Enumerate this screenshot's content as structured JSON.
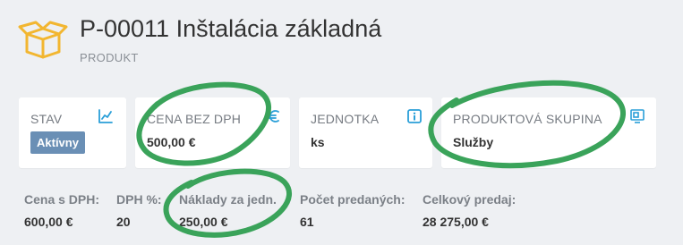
{
  "header": {
    "title": "P-00011 Inštalácia základná",
    "subtitle": "PRODUKT",
    "icon": "box-icon"
  },
  "cards": [
    {
      "label": "STAV",
      "value": "Aktívny",
      "icon": "trend-chart-icon"
    },
    {
      "label": "CENA BEZ DPH",
      "value": "500,00 €",
      "icon": "euro-icon"
    },
    {
      "label": "JEDNOTKA",
      "value": "ks",
      "icon": "info-icon"
    },
    {
      "label": "PRODUKTOVÁ SKUPINA",
      "value": "Služby",
      "icon": "group-icon"
    }
  ],
  "stats": [
    {
      "label": "Cena s DPH:",
      "value": "600,00 €"
    },
    {
      "label": "DPH %:",
      "value": "20"
    },
    {
      "label": "Náklady za jedn.",
      "value": "250,00 €"
    },
    {
      "label": "Počet predaných:",
      "value": "61"
    },
    {
      "label": "Celkový predaj:",
      "value": "28 275,00 €"
    }
  ],
  "colors": {
    "accent": "#2a9fd8",
    "icon_yellow": "#f2b630",
    "badge": "#6a8fb5",
    "highlight": "#3aa35a"
  }
}
